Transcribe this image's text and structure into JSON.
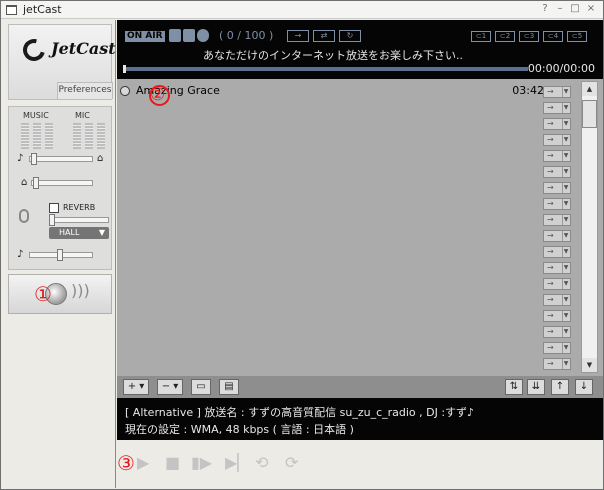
{
  "window": {
    "title": "jetCast",
    "help_label": "?",
    "minimize_label": "–",
    "maximize_label": "□",
    "close_label": "×"
  },
  "brand": {
    "logo_text": "JetCast",
    "preferences_label": "Preferences"
  },
  "mixer": {
    "music_label": "MUSIC",
    "mic_label": "MIC",
    "reverb_label": "REVERB",
    "reverb_checked": false,
    "hall_value": "HALL",
    "hall_arrow": "▼"
  },
  "status": {
    "onair_label": "ON AIR",
    "counter": "0 / 100",
    "counter_open": "(",
    "counter_close": ")",
    "mode_labels": [
      "→",
      "⇄",
      "↻"
    ],
    "channel_labels": [
      "⊂1",
      "⊂2",
      "⊂3",
      "⊂4",
      "⊂5"
    ],
    "message": "あなただけのインターネット放送をお楽しみ下さい..",
    "time": "00:00/00:00",
    "progress": 0.0
  },
  "playlist": {
    "tracks": [
      {
        "title": "Amazing Grace",
        "duration": "03:42"
      }
    ],
    "row_button_label": "→",
    "row_button_drop": "▼",
    "scroll_up": "▲",
    "scroll_down": "▼"
  },
  "toolbar": {
    "add_label": "+ ▾",
    "remove_label": "− ▾",
    "open_folder_label": "▭",
    "save_label": "▤",
    "sort_label": "⇅",
    "sort_all_label": "⇊",
    "move_up_label": "↑",
    "move_down_label": "↓"
  },
  "info": {
    "line1": "[ Alternative ] 放送名 : すずの高音質配信 su_zu_c_radio , DJ :すず♪",
    "line2": "現在の設定 :  WMA, 48 kbps ( 言語 : 日本語 )"
  },
  "transport": {
    "play_label": "▶",
    "stop_label": "■",
    "pause_label": "▮▶",
    "next_label": "▶▏",
    "repeat_label": "⟲",
    "repeat_one_label": "⟳"
  },
  "callouts": [
    "①",
    "②",
    "③"
  ],
  "colors": {
    "panel_black": "#050505",
    "lcd_blue": "#7f8fa6",
    "playlist_gray": "#ababab",
    "callout_red": "#e21b1b"
  }
}
